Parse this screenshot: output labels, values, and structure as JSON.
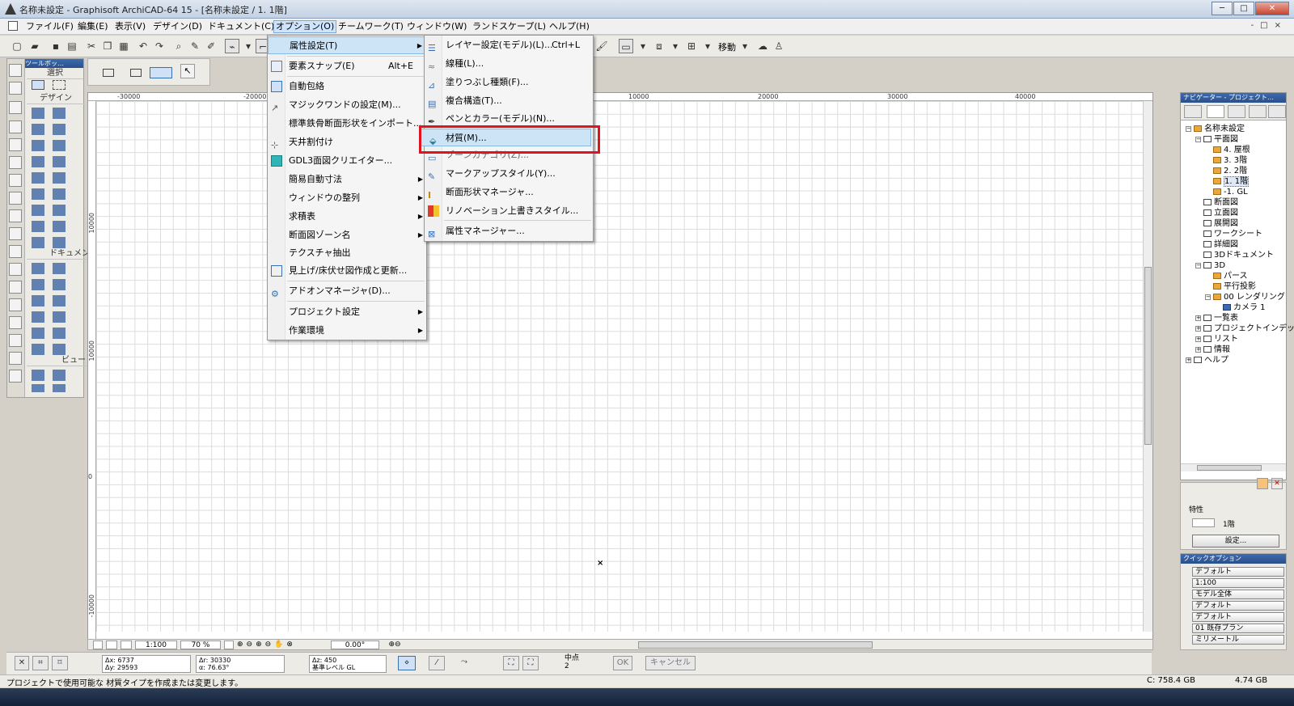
{
  "window": {
    "title": "名称未設定 - Graphisoft ArchiCAD-64 15 - [名称未設定 / 1. 1階]",
    "buttons": {
      "minimize": "─",
      "maximize": "□",
      "close": "✕"
    }
  },
  "menubar": {
    "items": [
      {
        "label": "ファイル(F)"
      },
      {
        "label": "編集(E)"
      },
      {
        "label": "表示(V)"
      },
      {
        "label": "デザイン(D)"
      },
      {
        "label": "ドキュメント(C)"
      },
      {
        "label": "オプション(O)"
      },
      {
        "label": "チームワーク(T)"
      },
      {
        "label": "ウィンドウ(W)"
      },
      {
        "label": "ランドスケープ(L)"
      },
      {
        "label": "ヘルプ(H)"
      }
    ]
  },
  "toolbar": {
    "move_label": "移動"
  },
  "toolbox": {
    "title": "ツールボッ…",
    "sections": [
      "選択",
      "デザイン",
      "ドキュメント",
      "ビュー"
    ]
  },
  "rulers": {
    "top": [
      "-30000",
      "-20000",
      "10000",
      "20000",
      "30000",
      "40000"
    ],
    "left": [
      "10000",
      "10000",
      "0",
      "-10000"
    ]
  },
  "canvas_bottom": {
    "scale": "1:100",
    "zoom": "70 %",
    "angle": "0.00°"
  },
  "coordbar": {
    "dx": "Δx: 6737",
    "dy": "Δy: 29593",
    "dr": "Δr: 30330",
    "da": "α: 76.63°",
    "dz": "Δz: 450",
    "ref": "基準レベル GL",
    "snap_label": "中点",
    "snap_value": "2",
    "ok": "OK",
    "cancel": "キャンセル"
  },
  "status": {
    "message": "プロジェクトで使用可能な 材質タイプを作成または変更します。",
    "disk": "C: 758.4 GB",
    "memory": "4.74 GB"
  },
  "navigator": {
    "title": "ナビゲーター - プロジェクト…",
    "tree": [
      {
        "label": "名称未設定"
      },
      {
        "label": "平面図"
      },
      {
        "label": "4. 屋根"
      },
      {
        "label": "3. 3階"
      },
      {
        "label": "2. 2階"
      },
      {
        "label": "1. 1階"
      },
      {
        "label": "-1. GL"
      },
      {
        "label": "断面図"
      },
      {
        "label": "立面図"
      },
      {
        "label": "展開図"
      },
      {
        "label": "ワークシート"
      },
      {
        "label": "詳細図"
      },
      {
        "label": "3Dドキュメント"
      },
      {
        "label": "3D"
      },
      {
        "label": "パース"
      },
      {
        "label": "平行投影"
      },
      {
        "label": "00 レンダリング"
      },
      {
        "label": "カメラ 1"
      },
      {
        "label": "一覧表"
      },
      {
        "label": "プロジェクトインデッ"
      },
      {
        "label": "リスト"
      },
      {
        "label": "情報"
      },
      {
        "label": "ヘルプ"
      }
    ]
  },
  "properties": {
    "section": "特性",
    "name": "1階",
    "settings_button": "設定..."
  },
  "quick_options": {
    "title": "クイックオプション",
    "rows": [
      "デフォルト",
      "1:100",
      "モデル全体",
      "デフォルト",
      "デフォルト",
      "01 既存プラン",
      "ミリメートル"
    ]
  },
  "options_menu": {
    "items": [
      {
        "label": "属性設定(T)"
      },
      {
        "label": "要素スナップ(E)",
        "shortcut": "Alt+E"
      },
      {
        "label": "自動包絡"
      },
      {
        "label": "マジックワンドの設定(M)..."
      },
      {
        "label": "標準鉄骨断面形状をインポート..."
      },
      {
        "label": "天井割付け"
      },
      {
        "label": "GDL3面図クリエイター..."
      },
      {
        "label": "簡易自動寸法"
      },
      {
        "label": "ウィンドウの整列"
      },
      {
        "label": "求積表"
      },
      {
        "label": "断面図ゾーン名"
      },
      {
        "label": "テクスチャ抽出"
      },
      {
        "label": "見上げ/床伏せ図作成と更新..."
      },
      {
        "label": "アドオンマネージャ(D)..."
      },
      {
        "label": "プロジェクト設定"
      },
      {
        "label": "作業環境"
      }
    ]
  },
  "attributes_submenu": {
    "items": [
      {
        "label": "レイヤー設定(モデル)(L)...",
        "shortcut": "Ctrl+L"
      },
      {
        "label": "線種(L)..."
      },
      {
        "label": "塗りつぶし種類(F)..."
      },
      {
        "label": "複合構造(T)..."
      },
      {
        "label": "ペンとカラー(モデル)(N)..."
      },
      {
        "label": "材質(M)..."
      },
      {
        "label": "ゾーンカテゴリ(Z)..."
      },
      {
        "label": "マークアップスタイル(Y)..."
      },
      {
        "label": "断面形状マネージャ..."
      },
      {
        "label": "リノベーション上書きスタイル..."
      },
      {
        "label": "属性マネージャー..."
      }
    ]
  },
  "colors": {
    "highlight": "#cde4f7",
    "callout": "#e0141e",
    "titlebar": "#2a4f8a"
  }
}
